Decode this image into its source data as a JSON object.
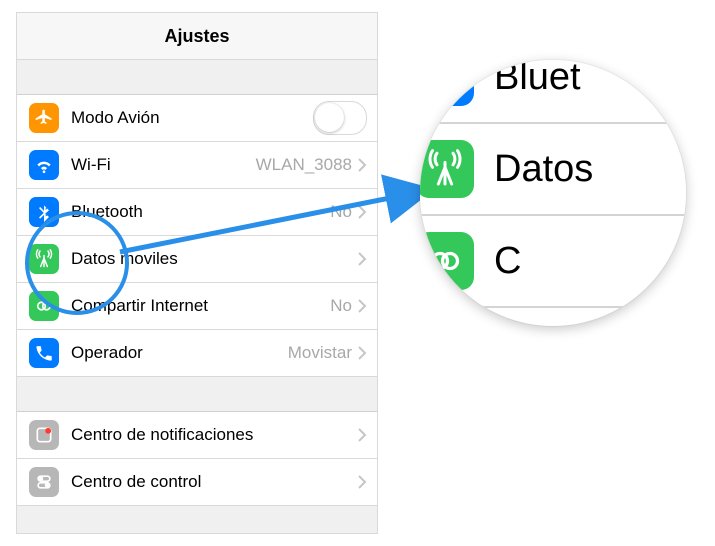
{
  "header": {
    "title": "Ajustes"
  },
  "rows": {
    "airplane": {
      "label": "Modo Avión"
    },
    "wifi": {
      "label": "Wi-Fi",
      "value": "WLAN_3088"
    },
    "bluetooth": {
      "label": "Bluetooth",
      "value": "No"
    },
    "cellular": {
      "label": "Datos moviles"
    },
    "hotspot": {
      "label": "Compartir Internet",
      "value": "No"
    },
    "carrier": {
      "label": "Operador",
      "value": "Movistar"
    },
    "notif": {
      "label": "Centro de notificaciones"
    },
    "control": {
      "label": "Centro de control"
    }
  },
  "zoom": {
    "bluetooth": "Bluet",
    "cellular": "Datos",
    "hotspot": "C"
  }
}
